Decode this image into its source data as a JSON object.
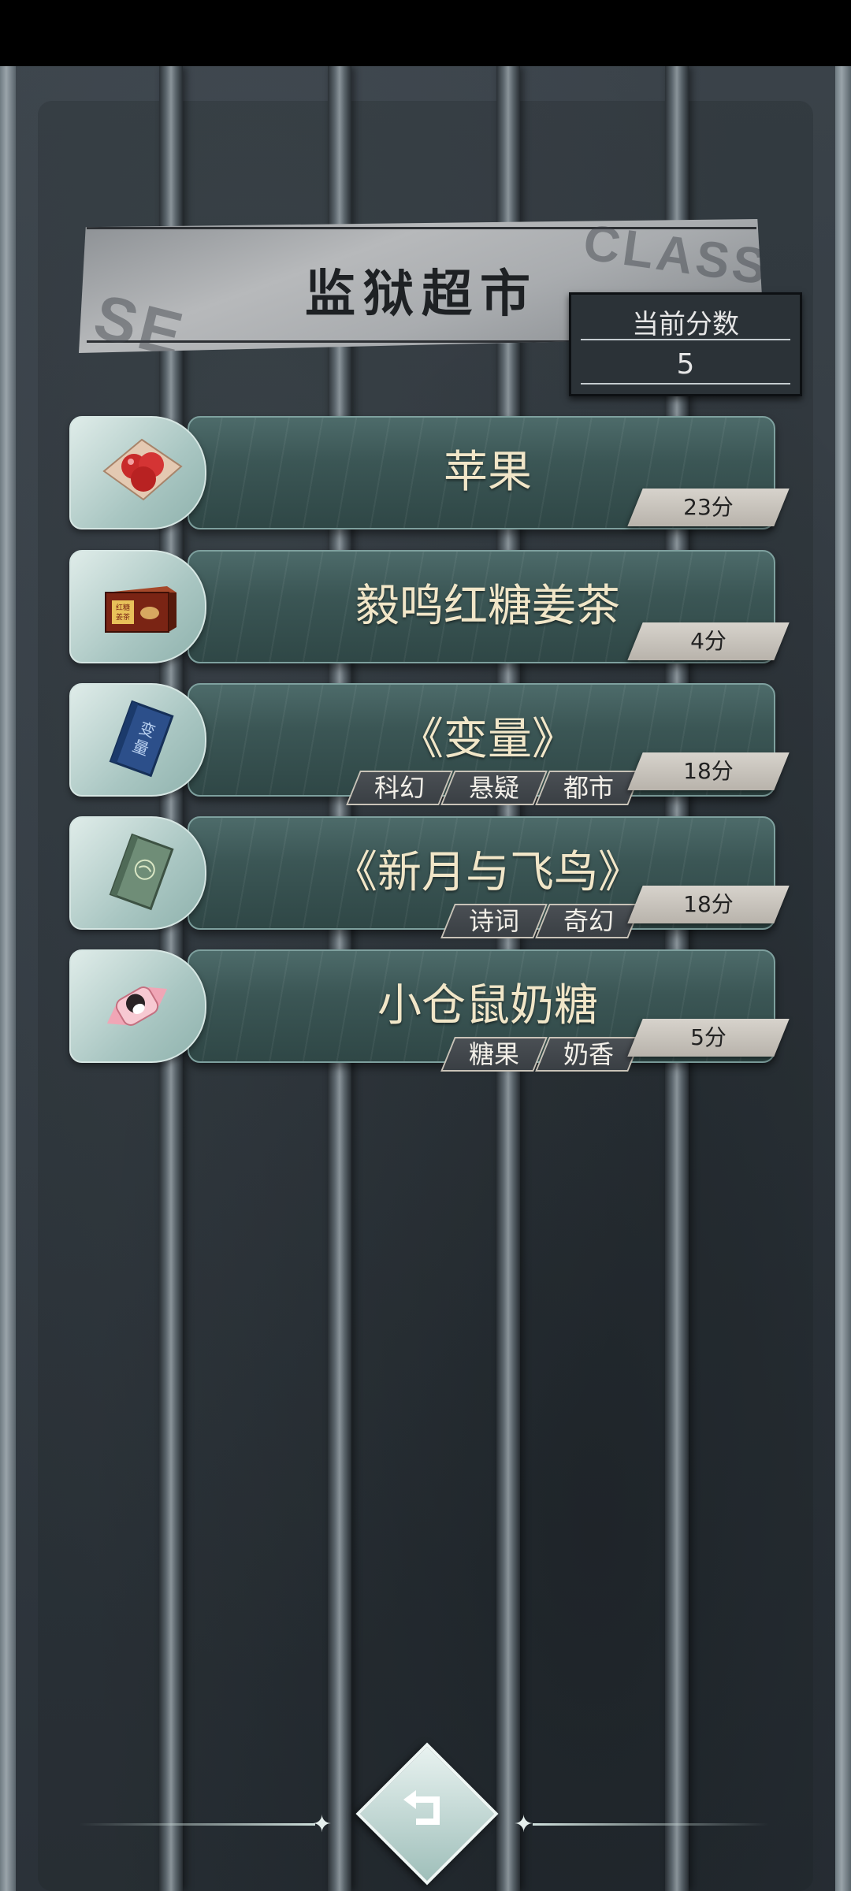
{
  "header": {
    "title": "监狱超市",
    "score_label": "当前分数",
    "score_value": "5"
  },
  "items": [
    {
      "name": "苹果",
      "icon": "apple-icon",
      "tags": [],
      "price": "23分"
    },
    {
      "name": "毅鸣红糖姜茶",
      "icon": "ginger-tea-box-icon",
      "icon_text": "红糖姜茶",
      "tags": [],
      "price": "4分"
    },
    {
      "name": "《变量》",
      "icon": "book-icon",
      "icon_text": "变量",
      "tags": [
        "科幻",
        "悬疑",
        "都市"
      ],
      "price": "18分"
    },
    {
      "name": "《新月与飞鸟》",
      "icon": "poetry-book-icon",
      "tags": [
        "诗词",
        "奇幻"
      ],
      "price": "18分"
    },
    {
      "name": "小仓鼠奶糖",
      "icon": "candy-icon",
      "tags": [
        "糖果",
        "奶香"
      ],
      "price": "5分"
    }
  ],
  "footer": {
    "back_icon": "back-arrow-icon"
  },
  "colors": {
    "card": "#3b5655",
    "title_text": "#1e2124",
    "item_text": "#f1e6c8",
    "price_tag": "#d7d3cc"
  }
}
